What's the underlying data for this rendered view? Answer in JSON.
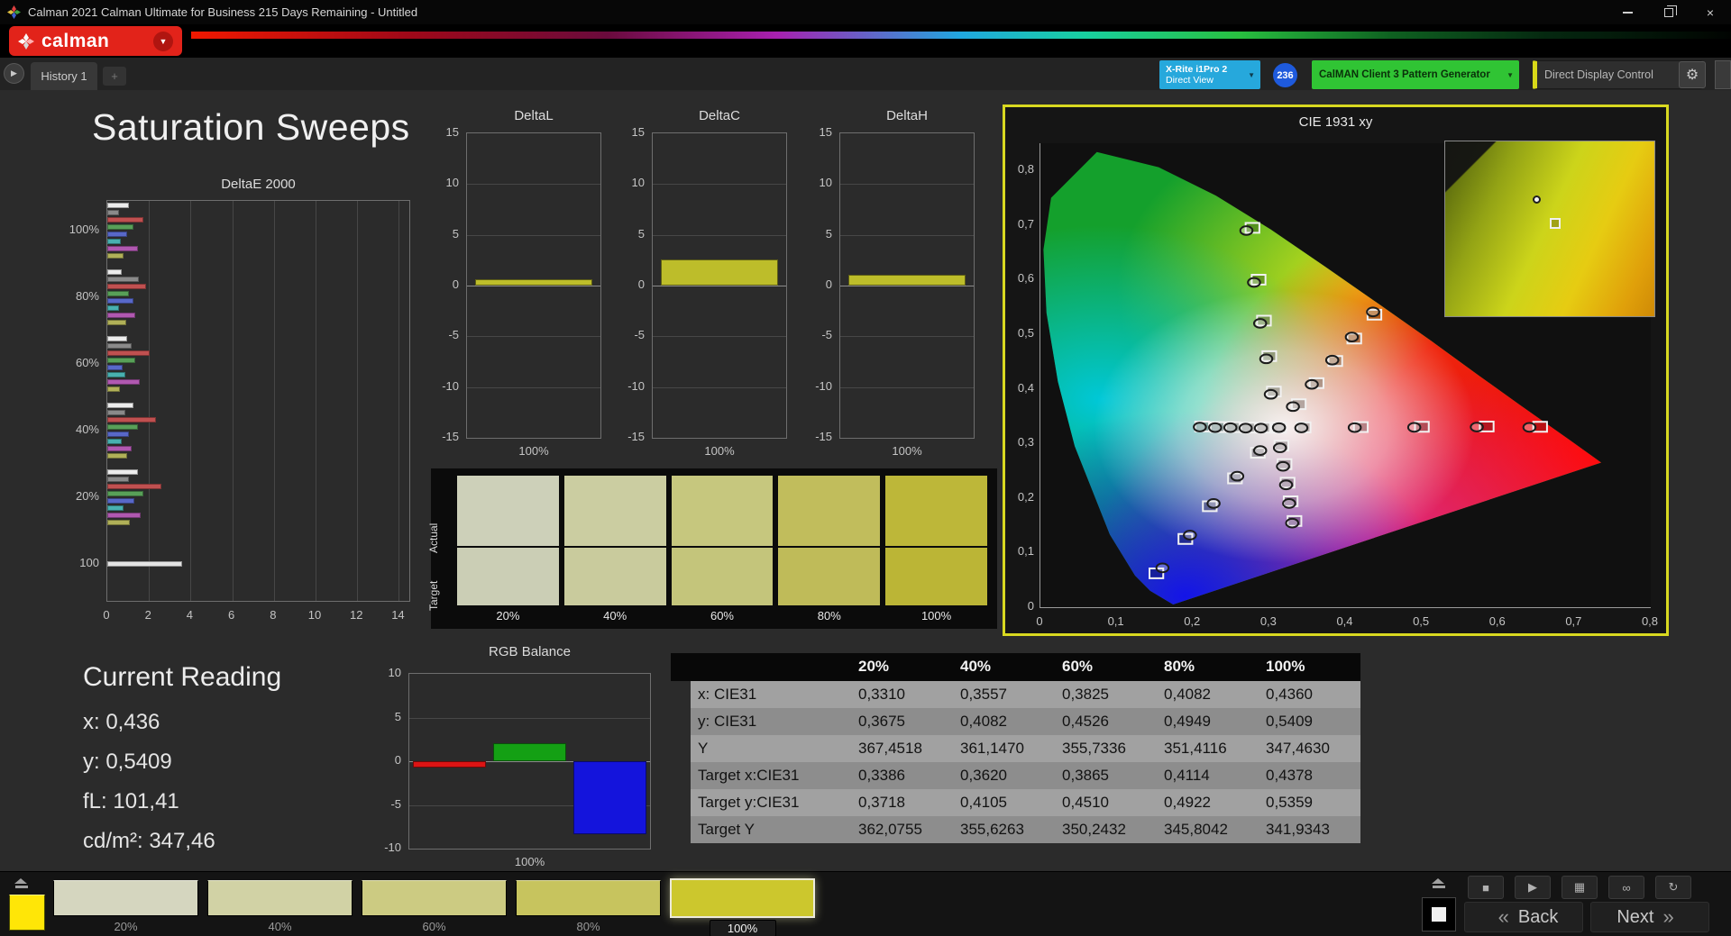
{
  "window": {
    "title": "Calman 2021 Calman Ultimate for Business 215 Days Remaining  - Untitled"
  },
  "brand": {
    "name": "calman"
  },
  "tabs": {
    "history": "History 1",
    "add": "+"
  },
  "device_bar": {
    "meter_line1": "X-Rite i1Pro 2",
    "meter_line2": "Direct View",
    "badge": "236",
    "pattern_generator": "CalMAN Client 3 Pattern Generator",
    "display_control": "Direct Display Control"
  },
  "page": {
    "title": "Saturation Sweeps"
  },
  "current_reading": {
    "title": "Current Reading",
    "lines": [
      "x: 0,436",
      "y: 0,5409",
      "fL: 101,41",
      "cd/m²: 347,46"
    ]
  },
  "swatch_panel": {
    "row_labels": [
      "Actual",
      "Target"
    ],
    "columns": [
      {
        "label": "20%",
        "actual": "#cdd0b9",
        "target": "#cbceb5"
      },
      {
        "label": "40%",
        "actual": "#cbcda1",
        "target": "#c9cb9d"
      },
      {
        "label": "60%",
        "actual": "#c6c77e",
        "target": "#c4c57b"
      },
      {
        "label": "80%",
        "actual": "#c1bd5c",
        "target": "#bfbb59"
      },
      {
        "label": "100%",
        "actual": "#bdb739",
        "target": "#bbb536"
      }
    ]
  },
  "table": {
    "headers": [
      "20%",
      "40%",
      "60%",
      "80%",
      "100%"
    ],
    "rows": [
      {
        "label": "x: CIE31",
        "values": [
          "0,3310",
          "0,3557",
          "0,3825",
          "0,4082",
          "0,4360"
        ]
      },
      {
        "label": "y: CIE31",
        "values": [
          "0,3675",
          "0,4082",
          "0,4526",
          "0,4949",
          "0,5409"
        ]
      },
      {
        "label": "Y",
        "values": [
          "367,4518",
          "361,1470",
          "355,7336",
          "351,4116",
          "347,4630"
        ]
      },
      {
        "label": "Target x:CIE31",
        "values": [
          "0,3386",
          "0,3620",
          "0,3865",
          "0,4114",
          "0,4378"
        ]
      },
      {
        "label": "Target y:CIE31",
        "values": [
          "0,3718",
          "0,4105",
          "0,4510",
          "0,4922",
          "0,5359"
        ]
      },
      {
        "label": "Target Y",
        "values": [
          "362,0755",
          "355,6263",
          "350,2432",
          "345,8042",
          "341,9343"
        ]
      }
    ]
  },
  "footer": {
    "pattern_color": "#ffe607",
    "swatches": [
      {
        "label": "20%",
        "color": "#d5d6bf"
      },
      {
        "label": "40%",
        "color": "#d1d2a5"
      },
      {
        "label": "60%",
        "color": "#cccb82"
      },
      {
        "label": "80%",
        "color": "#c7c45e"
      },
      {
        "label": "100%",
        "color": "#ccc72d"
      }
    ],
    "selected_index": 4,
    "back": "Back",
    "next": "Next"
  },
  "chart_data": [
    {
      "id": "deltae2000",
      "type": "bar",
      "orientation": "horizontal",
      "title": "DeltaE 2000",
      "xlim": [
        0,
        14.5
      ],
      "xticks": [
        0,
        2,
        4,
        6,
        8,
        10,
        12,
        14
      ],
      "groups": [
        {
          "label": "100%",
          "bars": [
            {
              "v": 1.05,
              "c": "#ececec"
            },
            {
              "v": 0.55,
              "c": "#8a8a8a"
            },
            {
              "v": 1.75,
              "c": "#c05050"
            },
            {
              "v": 1.25,
              "c": "#58a058"
            },
            {
              "v": 0.95,
              "c": "#5868c8"
            },
            {
              "v": 0.65,
              "c": "#48b0b0"
            },
            {
              "v": 1.45,
              "c": "#b058b0"
            },
            {
              "v": 0.8,
              "c": "#b0b058"
            }
          ]
        },
        {
          "label": "80%",
          "bars": [
            {
              "v": 0.7,
              "c": "#ececec"
            },
            {
              "v": 1.5,
              "c": "#8a8a8a"
            },
            {
              "v": 1.85,
              "c": "#c05050"
            },
            {
              "v": 1.05,
              "c": "#58a058"
            },
            {
              "v": 1.25,
              "c": "#5868c8"
            },
            {
              "v": 0.55,
              "c": "#48b0b0"
            },
            {
              "v": 1.35,
              "c": "#b058b0"
            },
            {
              "v": 0.9,
              "c": "#b0b058"
            }
          ]
        },
        {
          "label": "60%",
          "bars": [
            {
              "v": 0.95,
              "c": "#ececec"
            },
            {
              "v": 1.15,
              "c": "#8a8a8a"
            },
            {
              "v": 2.05,
              "c": "#c05050"
            },
            {
              "v": 1.35,
              "c": "#58a058"
            },
            {
              "v": 0.75,
              "c": "#5868c8"
            },
            {
              "v": 0.85,
              "c": "#48b0b0"
            },
            {
              "v": 1.55,
              "c": "#b058b0"
            },
            {
              "v": 0.6,
              "c": "#b0b058"
            }
          ]
        },
        {
          "label": "40%",
          "bars": [
            {
              "v": 1.25,
              "c": "#ececec"
            },
            {
              "v": 0.85,
              "c": "#8a8a8a"
            },
            {
              "v": 2.35,
              "c": "#c05050"
            },
            {
              "v": 1.45,
              "c": "#58a058"
            },
            {
              "v": 1.05,
              "c": "#5868c8"
            },
            {
              "v": 0.7,
              "c": "#48b0b0"
            },
            {
              "v": 1.15,
              "c": "#b058b0"
            },
            {
              "v": 0.95,
              "c": "#b0b058"
            }
          ]
        },
        {
          "label": "20%",
          "bars": [
            {
              "v": 1.45,
              "c": "#ececec"
            },
            {
              "v": 1.05,
              "c": "#8a8a8a"
            },
            {
              "v": 2.6,
              "c": "#c05050"
            },
            {
              "v": 1.75,
              "c": "#58a058"
            },
            {
              "v": 1.3,
              "c": "#5868c8"
            },
            {
              "v": 0.8,
              "c": "#48b0b0"
            },
            {
              "v": 1.6,
              "c": "#b058b0"
            },
            {
              "v": 1.1,
              "c": "#b0b058"
            }
          ]
        },
        {
          "label": "100",
          "bars": [
            {
              "v": 3.6,
              "c": "#e4e4e4"
            }
          ]
        }
      ]
    },
    {
      "id": "deltaL",
      "type": "bar",
      "title": "DeltaL",
      "ylim": [
        -15,
        15
      ],
      "yticks": [
        15,
        10,
        5,
        0,
        -5,
        -10,
        -15
      ],
      "xlabel": "100%",
      "bar_width": 0.88,
      "values": [
        {
          "v": 0.6,
          "c": "#bdbd2a"
        }
      ]
    },
    {
      "id": "deltaC",
      "type": "bar",
      "title": "DeltaC",
      "ylim": [
        -15,
        15
      ],
      "yticks": [
        15,
        10,
        5,
        0,
        -5,
        -10,
        -15
      ],
      "xlabel": "100%",
      "bar_width": 0.88,
      "values": [
        {
          "v": 2.6,
          "c": "#bdbd2a"
        }
      ]
    },
    {
      "id": "deltaH",
      "type": "bar",
      "title": "DeltaH",
      "ylim": [
        -15,
        15
      ],
      "yticks": [
        15,
        10,
        5,
        0,
        -5,
        -10,
        -15
      ],
      "xlabel": "100%",
      "bar_width": 0.88,
      "values": [
        {
          "v": 1.1,
          "c": "#bdbd2a"
        }
      ]
    },
    {
      "id": "rgbbalance",
      "type": "bar",
      "title": "RGB Balance",
      "ylim": [
        -10,
        10
      ],
      "yticks": [
        10,
        5,
        0,
        -5,
        -10
      ],
      "xlabel": "100%",
      "bar_width": 0.92,
      "values": [
        {
          "v": -0.7,
          "c": "#dc1414"
        },
        {
          "v": 2.1,
          "c": "#14a014"
        },
        {
          "v": -8.3,
          "c": "#1414dc"
        }
      ]
    },
    {
      "id": "cie1931",
      "type": "scatter",
      "title": "CIE 1931 xy",
      "xlim": [
        0,
        0.8
      ],
      "ylim": [
        0,
        0.85
      ],
      "xticks": [
        {
          "v": 0,
          "label": "0"
        },
        {
          "v": 0.1,
          "label": "0,1"
        },
        {
          "v": 0.2,
          "label": "0,2"
        },
        {
          "v": 0.3,
          "label": "0,3"
        },
        {
          "v": 0.4,
          "label": "0,4"
        },
        {
          "v": 0.5,
          "label": "0,5"
        },
        {
          "v": 0.6,
          "label": "0,6"
        },
        {
          "v": 0.7,
          "label": "0,7"
        },
        {
          "v": 0.8,
          "label": "0,8"
        }
      ],
      "yticks": [
        {
          "v": 0,
          "label": "0"
        },
        {
          "v": 0.1,
          "label": "0,1"
        },
        {
          "v": 0.2,
          "label": "0,2"
        },
        {
          "v": 0.3,
          "label": "0,3"
        },
        {
          "v": 0.4,
          "label": "0,4"
        },
        {
          "v": 0.5,
          "label": "0,5"
        },
        {
          "v": 0.6,
          "label": "0,6"
        },
        {
          "v": 0.7,
          "label": "0,7"
        },
        {
          "v": 0.8,
          "label": "0,8"
        }
      ],
      "sweeps": [
        {
          "name": "white",
          "measured": [
            [
              0.3127,
              0.329
            ]
          ],
          "target": [
            [
              0.3127,
              0.329
            ]
          ]
        },
        {
          "name": "red",
          "measured": [
            [
              0.342,
              0.3285
            ],
            [
              0.412,
              0.329
            ],
            [
              0.49,
              0.3295
            ],
            [
              0.572,
              0.33
            ],
            [
              0.641,
              0.3295
            ]
          ],
          "target": [
            [
              0.345,
              0.3295
            ],
            [
              0.42,
              0.33
            ],
            [
              0.5,
              0.3305
            ],
            [
              0.585,
              0.331
            ],
            [
              0.655,
              0.3305
            ]
          ]
        },
        {
          "name": "green",
          "measured": [
            [
              0.302,
              0.39
            ],
            [
              0.296,
              0.455
            ],
            [
              0.288,
              0.52
            ],
            [
              0.28,
              0.595
            ],
            [
              0.27,
              0.69
            ]
          ],
          "target": [
            [
              0.306,
              0.395
            ],
            [
              0.3,
              0.46
            ],
            [
              0.293,
              0.525
            ],
            [
              0.286,
              0.6
            ],
            [
              0.278,
              0.695
            ]
          ]
        },
        {
          "name": "blue",
          "measured": [
            [
              0.288,
              0.287
            ],
            [
              0.258,
              0.24
            ],
            [
              0.227,
              0.19
            ],
            [
              0.196,
              0.132
            ],
            [
              0.16,
              0.072
            ]
          ],
          "target": [
            [
              0.285,
              0.283
            ],
            [
              0.255,
              0.236
            ],
            [
              0.222,
              0.185
            ],
            [
              0.19,
              0.125
            ],
            [
              0.152,
              0.062
            ]
          ]
        },
        {
          "name": "cyan",
          "measured": [
            [
              0.289,
              0.328
            ],
            [
              0.269,
              0.328
            ],
            [
              0.249,
              0.329
            ],
            [
              0.229,
              0.329
            ],
            [
              0.209,
              0.33
            ]
          ],
          "target": [
            [
              0.292,
              0.329
            ],
            [
              0.272,
              0.329
            ],
            [
              0.252,
              0.33
            ],
            [
              0.232,
              0.33
            ],
            [
              0.212,
              0.331
            ]
          ]
        },
        {
          "name": "magenta",
          "measured": [
            [
              0.314,
              0.292
            ],
            [
              0.318,
              0.258
            ],
            [
              0.322,
              0.224
            ],
            [
              0.326,
              0.19
            ],
            [
              0.33,
              0.154
            ]
          ],
          "target": [
            [
              0.316,
              0.296
            ],
            [
              0.32,
              0.262
            ],
            [
              0.324,
              0.228
            ],
            [
              0.328,
              0.194
            ],
            [
              0.333,
              0.158
            ]
          ]
        },
        {
          "name": "yellow",
          "measured": [
            [
              0.331,
              0.3675
            ],
            [
              0.3557,
              0.4082
            ],
            [
              0.3825,
              0.4526
            ],
            [
              0.4082,
              0.4949
            ],
            [
              0.436,
              0.5409
            ]
          ],
          "target": [
            [
              0.3386,
              0.3718
            ],
            [
              0.362,
              0.4105
            ],
            [
              0.3865,
              0.451
            ],
            [
              0.4114,
              0.4922
            ],
            [
              0.4378,
              0.5359
            ]
          ]
        }
      ]
    }
  ]
}
